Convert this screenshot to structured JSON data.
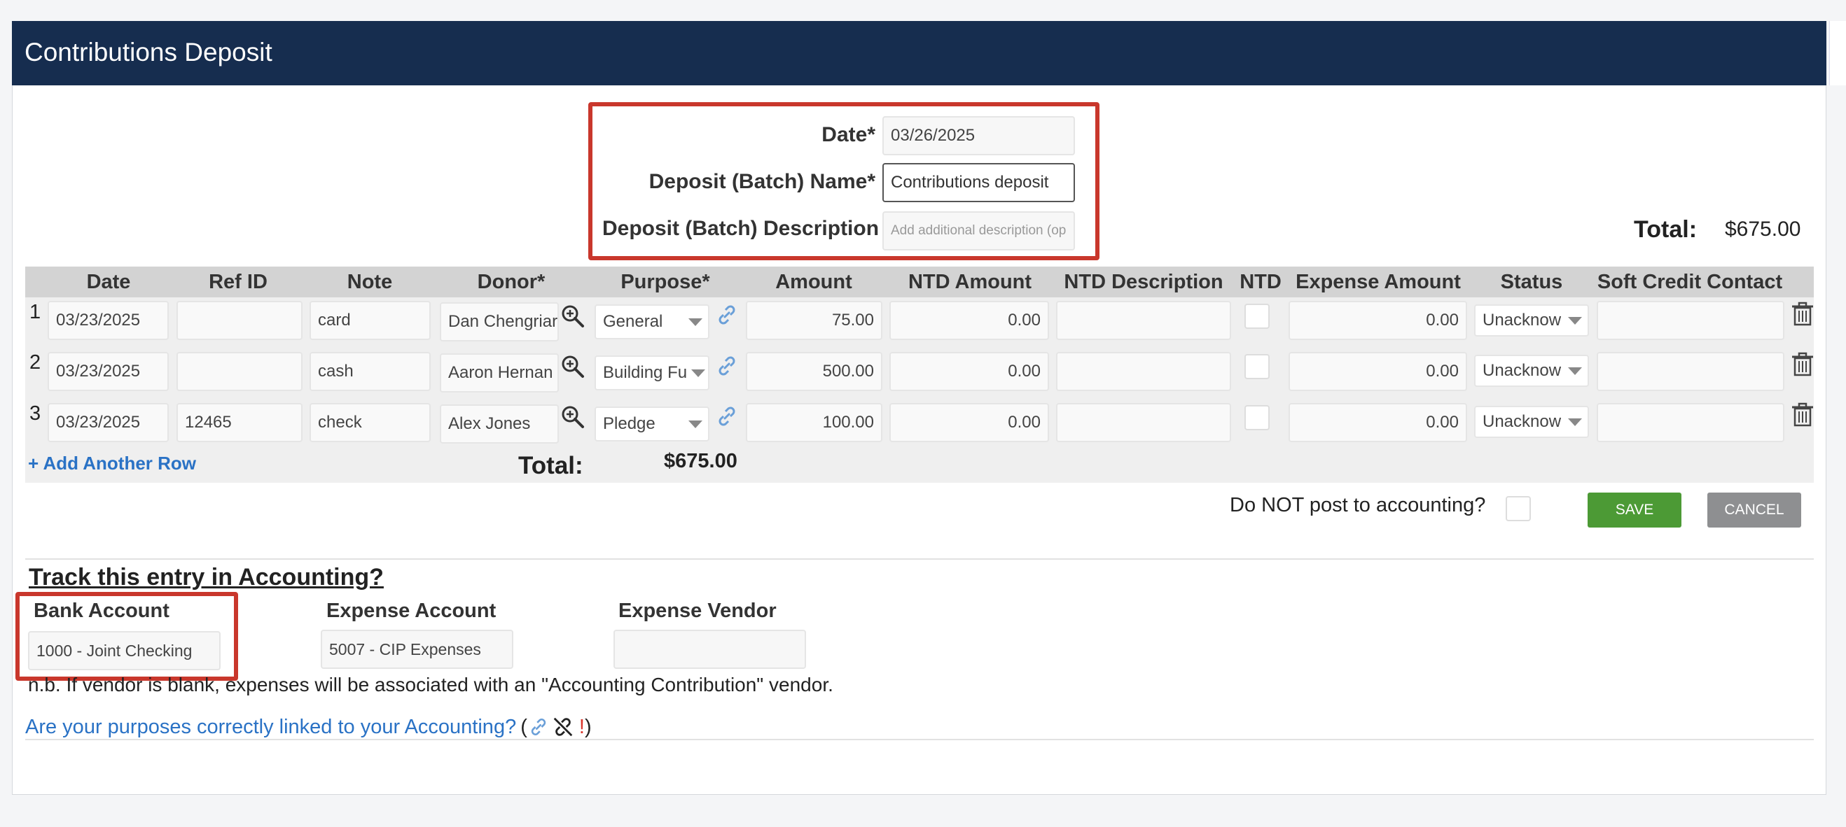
{
  "page_title": "Contributions Deposit",
  "batch": {
    "date_label": "Date*",
    "date_value": "03/26/2025",
    "name_label": "Deposit (Batch) Name*",
    "name_value": "Contributions deposit",
    "description_label": "Deposit (Batch) Description",
    "description_placeholder": "Add additional description (op"
  },
  "header_total": {
    "label": "Total:",
    "value": "$675.00"
  },
  "columns": [
    "Date",
    "Ref ID",
    "Note",
    "Donor*",
    "Purpose*",
    "Amount",
    "NTD Amount",
    "NTD Description",
    "NTD",
    "Expense Amount",
    "Status",
    "Soft Credit Contact"
  ],
  "rows": [
    {
      "num": "1",
      "date": "03/23/2025",
      "ref_id": "",
      "note": "card",
      "donor": "Dan Chengriar",
      "purpose": "General",
      "amount": "75.00",
      "ntd_amount": "0.00",
      "ntd_description": "",
      "ntd_checked": false,
      "expense_amount": "0.00",
      "status": "Unacknow",
      "soft_credit": ""
    },
    {
      "num": "2",
      "date": "03/23/2025",
      "ref_id": "",
      "note": "cash",
      "donor": "Aaron Hernan",
      "purpose": "Building Fu",
      "amount": "500.00",
      "ntd_amount": "0.00",
      "ntd_description": "",
      "ntd_checked": false,
      "expense_amount": "0.00",
      "status": "Unacknow",
      "soft_credit": ""
    },
    {
      "num": "3",
      "date": "03/23/2025",
      "ref_id": "12465",
      "note": "check",
      "donor": "Alex Jones",
      "purpose": "Pledge",
      "amount": "100.00",
      "ntd_amount": "0.00",
      "ntd_description": "",
      "ntd_checked": false,
      "expense_amount": "0.00",
      "status": "Unacknow",
      "soft_credit": ""
    }
  ],
  "add_row_label": "+ Add Another Row",
  "grid_total": {
    "label": "Total:",
    "value": "$675.00"
  },
  "do_not_post_label": "Do NOT post to accounting?",
  "save_label": "SAVE",
  "cancel_label": "CANCEL",
  "accounting": {
    "heading": "Track this entry in Accounting?",
    "bank_account_label": "Bank Account",
    "bank_account_value": "1000 - Joint Checking",
    "expense_account_label": "Expense Account",
    "expense_account_value": "5007 - CIP Expenses",
    "expense_vendor_label": "Expense Vendor",
    "expense_vendor_value": "",
    "note": "n.b. If vendor is blank, expenses will be associated with an \"Accounting Contribution\" vendor.",
    "purposes_link": "Are your purposes correctly linked to your Accounting?",
    "paren_open": "(",
    "paren_close": ")",
    "warning_mark": "!"
  },
  "icons": {
    "search": "magnifier-plus-icon",
    "link": "link-icon",
    "unlink": "broken-link-icon",
    "trash": "trash-icon"
  },
  "colors": {
    "header_bg": "#162d4f",
    "save_green": "#4c9a35",
    "cancel_gray": "#8e8f91",
    "highlight_red": "#c9372c",
    "link_blue": "#2a72c5"
  }
}
